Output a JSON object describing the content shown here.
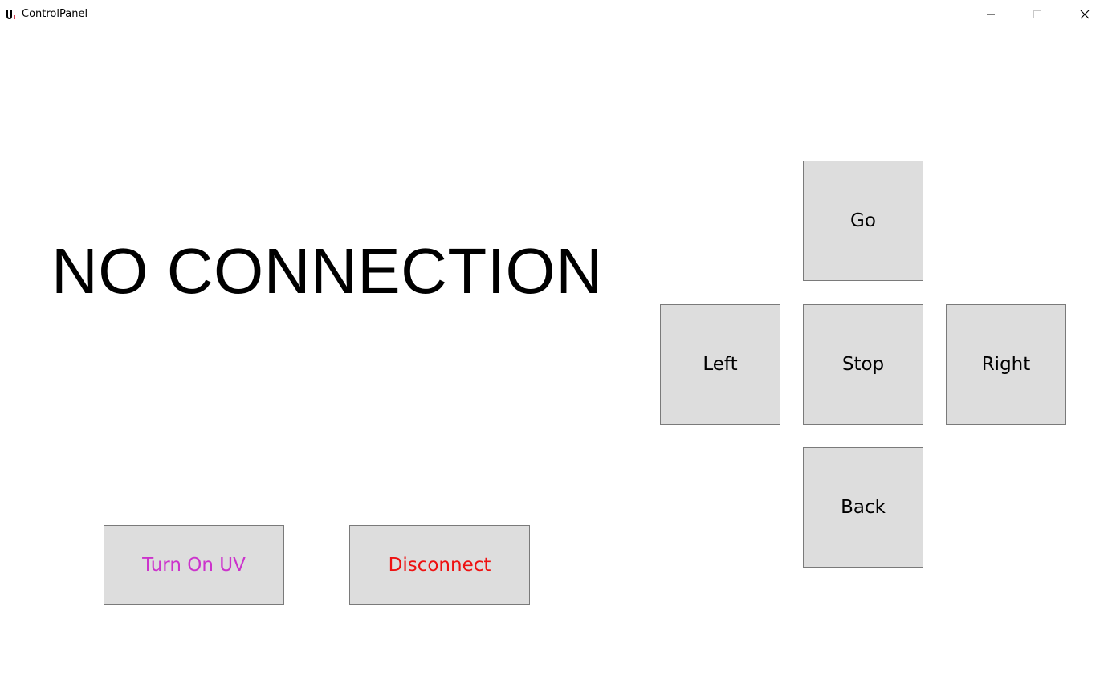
{
  "window": {
    "title": "ControlPanel",
    "app_icon": "app-u-logo-icon",
    "controls": {
      "minimize_icon": "minimize-icon",
      "maximize_icon": "maximize-icon",
      "close_icon": "close-icon"
    }
  },
  "status": {
    "text": "NO CONNECTION",
    "color": "#000000"
  },
  "direction_pad": {
    "go": "Go",
    "left": "Left",
    "stop": "Stop",
    "right": "Right",
    "back": "Back"
  },
  "actions": {
    "uv": {
      "label": "Turn On UV",
      "color": "#cc33cc"
    },
    "disconnect": {
      "label": "Disconnect",
      "color": "#ee1111"
    }
  },
  "colors": {
    "button_bg": "#dddddd",
    "button_border": "#7a7a7a",
    "background": "#ffffff"
  }
}
